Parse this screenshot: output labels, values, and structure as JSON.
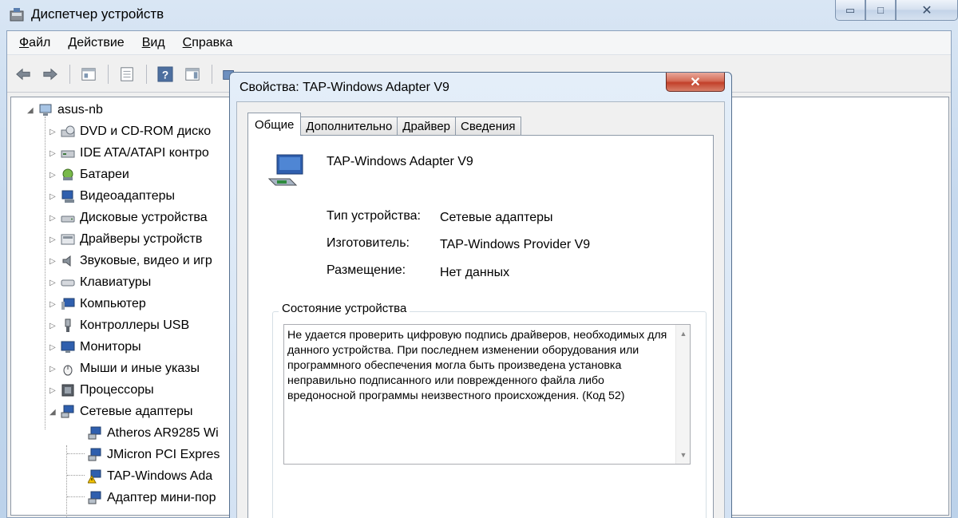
{
  "window": {
    "title": "Диспетчер устройств",
    "controls": {
      "minimize": "▭",
      "maximize": "□",
      "close": "✕"
    }
  },
  "menu": [
    {
      "label": "Файл",
      "accel": "Ф",
      "rest": "айл"
    },
    {
      "label": "Действие",
      "accel": "Д",
      "rest": "ействие"
    },
    {
      "label": "Вид",
      "accel": "В",
      "rest": "ид"
    },
    {
      "label": "Справка",
      "accel": "С",
      "rest": "правка"
    }
  ],
  "toolbar": {
    "buttons": [
      "back-icon",
      "forward-icon",
      "show-hide-tree-icon",
      "properties-icon",
      "help-icon",
      "action-pane-icon",
      "scan-hardware-icon"
    ]
  },
  "tree": {
    "root": "asus-nb",
    "items": [
      {
        "label": "DVD и CD-ROM диско",
        "icon": "dvd-drive-icon"
      },
      {
        "label": "IDE ATA/ATAPI контро",
        "icon": "ide-controller-icon"
      },
      {
        "label": "Батареи",
        "icon": "battery-icon"
      },
      {
        "label": "Видеоадаптеры",
        "icon": "display-adapter-icon"
      },
      {
        "label": "Дисковые устройства",
        "icon": "disk-drive-icon"
      },
      {
        "label": "Драйверы устройств",
        "icon": "device-driver-icon"
      },
      {
        "label": "Звуковые, видео и игр",
        "icon": "sound-icon"
      },
      {
        "label": "Клавиатуры",
        "icon": "keyboard-icon"
      },
      {
        "label": "Компьютер",
        "icon": "computer-icon"
      },
      {
        "label": "Контроллеры USB",
        "icon": "usb-icon"
      },
      {
        "label": "Мониторы",
        "icon": "monitor-icon"
      },
      {
        "label": "Мыши и иные указы",
        "icon": "mouse-icon"
      },
      {
        "label": "Процессоры",
        "icon": "processor-icon"
      },
      {
        "label": "Сетевые адаптеры",
        "icon": "network-adapter-icon",
        "expanded": true
      }
    ],
    "network_children": [
      {
        "label": "Atheros AR9285 Wi",
        "warning": false
      },
      {
        "label": "JMicron PCI Expres",
        "warning": false
      },
      {
        "label": "TAP-Windows Ada",
        "warning": true
      },
      {
        "label": "Адаптер мини-пор",
        "warning": false
      }
    ]
  },
  "dialog": {
    "title": "Свойства: TAP-Windows Adapter V9",
    "close": "✕",
    "tabs": [
      "Общие",
      "Дополнительно",
      "Драйвер",
      "Сведения"
    ],
    "active_tab": "Общие",
    "device_name": "TAP-Windows Adapter V9",
    "props": [
      {
        "label": "Тип устройства:",
        "value": "Сетевые адаптеры"
      },
      {
        "label": "Изготовитель:",
        "value": "TAP-Windows Provider V9"
      },
      {
        "label": "Размещение:",
        "value": "Нет данных"
      }
    ],
    "status_group_label": "Состояние устройства",
    "status_text": "Не удается проверить цифровую подпись драйверов, необходимых для данного устройства. При последнем изменении оборудования или программного обеспечения могла быть произведена установка неправильно подписанного или поврежденного файла либо вредоносной программы неизвестного происхождения. (Код 52)"
  },
  "colors": {
    "accent": "#c2402a",
    "window_frame": "#c5d8ee",
    "warning": "#f2c200"
  }
}
